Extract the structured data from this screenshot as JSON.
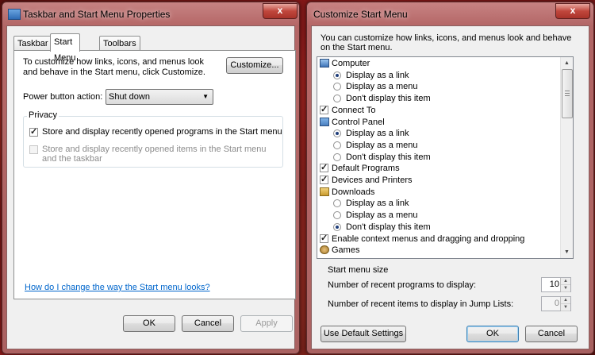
{
  "left_window": {
    "title": "Taskbar and Start Menu Properties",
    "tabs": [
      "Taskbar",
      "Start Menu",
      "Toolbars"
    ],
    "active_tab": "Start Menu",
    "description": "To customize how links, icons, and menus look and behave in the Start menu, click Customize.",
    "customize_button": "Customize...",
    "power_button_label": "Power button action:",
    "power_button_value": "Shut down",
    "privacy_label": "Privacy",
    "privacy_items": [
      {
        "label": "Store and display recently opened programs in the Start menu",
        "checked": true,
        "enabled": true
      },
      {
        "label": "Store and display recently opened items in the Start menu and the taskbar",
        "checked": false,
        "enabled": false
      }
    ],
    "help_link": "How do I change the way the Start menu looks?",
    "buttons": {
      "ok": "OK",
      "cancel": "Cancel",
      "apply": "Apply"
    }
  },
  "right_window": {
    "title": "Customize Start Menu",
    "description": "You can customize how links, icons, and menus look and behave on the Start menu.",
    "list": [
      {
        "type": "header",
        "icon": "computer-icon",
        "label": "Computer"
      },
      {
        "type": "radio",
        "label": "Display as a link",
        "selected": true
      },
      {
        "type": "radio",
        "label": "Display as a menu",
        "selected": false
      },
      {
        "type": "radio",
        "label": "Don't display this item",
        "selected": false
      },
      {
        "type": "check",
        "label": "Connect To",
        "checked": true
      },
      {
        "type": "header",
        "icon": "control-panel-icon",
        "label": "Control Panel"
      },
      {
        "type": "radio",
        "label": "Display as a link",
        "selected": true
      },
      {
        "type": "radio",
        "label": "Display as a menu",
        "selected": false
      },
      {
        "type": "radio",
        "label": "Don't display this item",
        "selected": false
      },
      {
        "type": "check",
        "label": "Default Programs",
        "checked": true
      },
      {
        "type": "check",
        "label": "Devices and Printers",
        "checked": true
      },
      {
        "type": "header",
        "icon": "downloads-icon",
        "label": "Downloads"
      },
      {
        "type": "radio",
        "label": "Display as a link",
        "selected": false
      },
      {
        "type": "radio",
        "label": "Display as a menu",
        "selected": false
      },
      {
        "type": "radio",
        "label": "Don't display this item",
        "selected": true
      },
      {
        "type": "check",
        "label": "Enable context menus and dragging and dropping",
        "checked": true
      },
      {
        "type": "header",
        "icon": "games-icon",
        "label": "Games"
      }
    ],
    "start_menu_size_label": "Start menu size",
    "recent_programs_label": "Number of recent programs to display:",
    "recent_programs_value": "10",
    "recent_items_label": "Number of recent items to display in Jump Lists:",
    "recent_items_value": "0",
    "buttons": {
      "default": "Use Default Settings",
      "ok": "OK",
      "cancel": "Cancel"
    }
  },
  "close_glyph": "x"
}
